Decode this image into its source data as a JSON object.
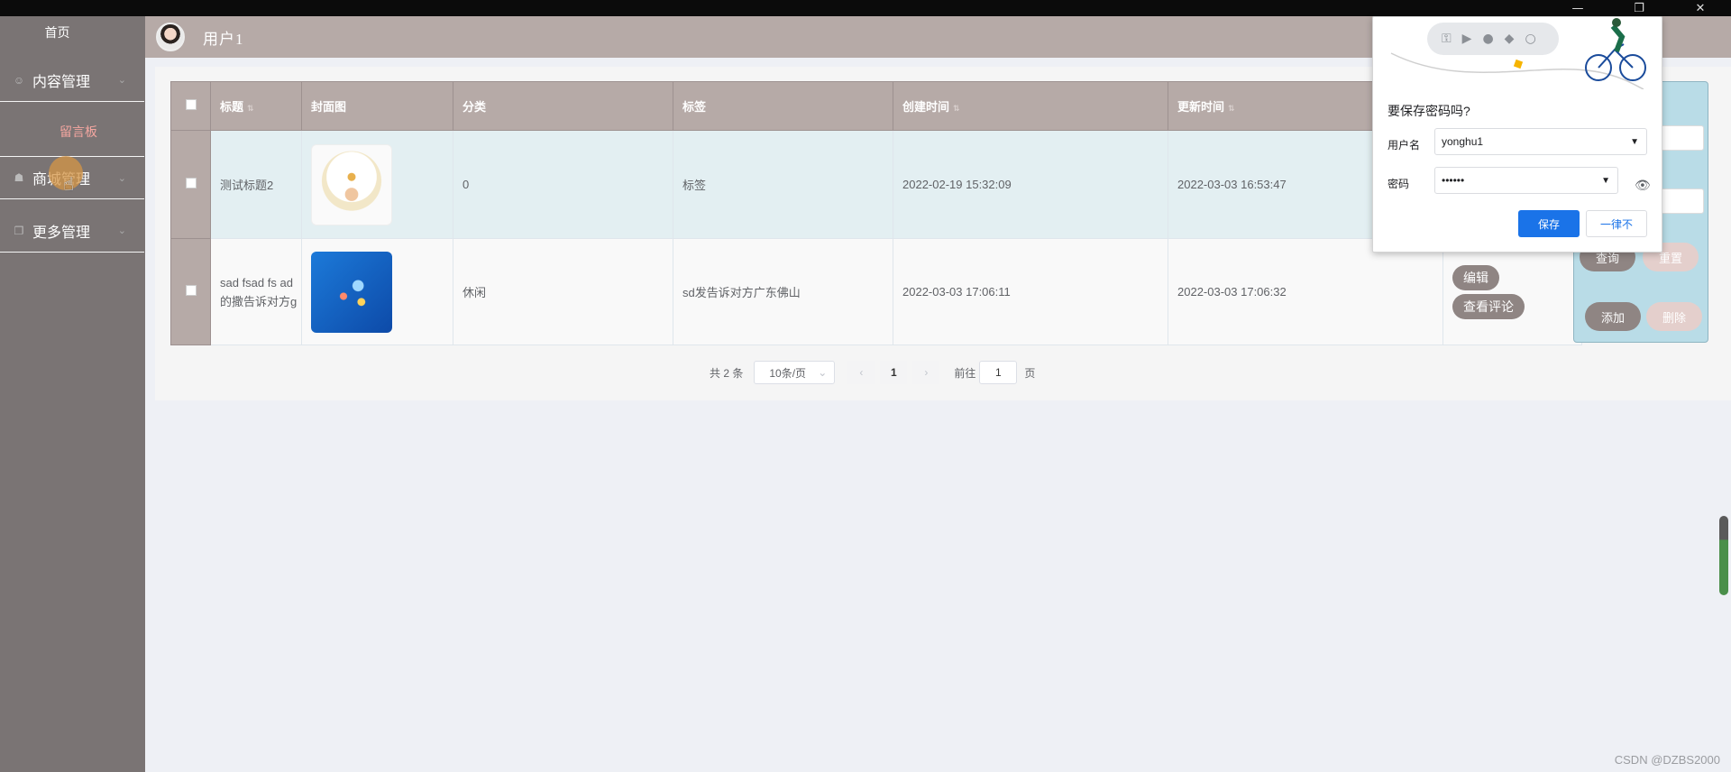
{
  "window": {
    "minimize_icon": "—",
    "restore_icon": "❐",
    "close_icon": "✕"
  },
  "sidebar": {
    "home": "首页",
    "items": [
      {
        "label": "内容管理",
        "icon": "content-icon"
      },
      {
        "label": "商城管理",
        "icon": "shop-icon"
      },
      {
        "label": "更多管理",
        "icon": "more-icon"
      }
    ],
    "sub_item": "留言板"
  },
  "header": {
    "user_name": "用户1"
  },
  "table": {
    "columns": [
      "标题",
      "封面图",
      "分类",
      "标签",
      "创建时间",
      "更新时间"
    ],
    "rows": [
      {
        "title": "测试标题2",
        "category": "0",
        "tags": "标签",
        "created": "2022-02-19 15:32:09",
        "updated": "2022-03-03 16:53:47",
        "cover": "cartoon-boy-thumbnail"
      },
      {
        "title": "sad fsad fs ad 的撒告诉对方g",
        "category": "休闲",
        "tags": "sd发告诉对方广东佛山",
        "created": "2022-03-03 17:06:11",
        "updated": "2022-03-03 17:06:32",
        "cover": "app-icons-hand-thumbnail",
        "actions": [
          "编辑",
          "查看评论"
        ]
      }
    ]
  },
  "search_panel": {
    "query_btn": "查询",
    "reset_btn": "重置",
    "add_btn": "添加",
    "delete_btn": "删除"
  },
  "pagination": {
    "total": "共 2 条",
    "page_size": "10条/页",
    "current": "1",
    "goto_label": "前往",
    "goto_value": "1",
    "page_unit": "页"
  },
  "save_password": {
    "title": "要保存密码吗?",
    "username_label": "用户名",
    "username_value": "yonghu1",
    "password_label": "密码",
    "password_value": "••••••",
    "save_btn": "保存",
    "never_btn": "一律不"
  },
  "watermark": "CSDN @DZBS2000"
}
